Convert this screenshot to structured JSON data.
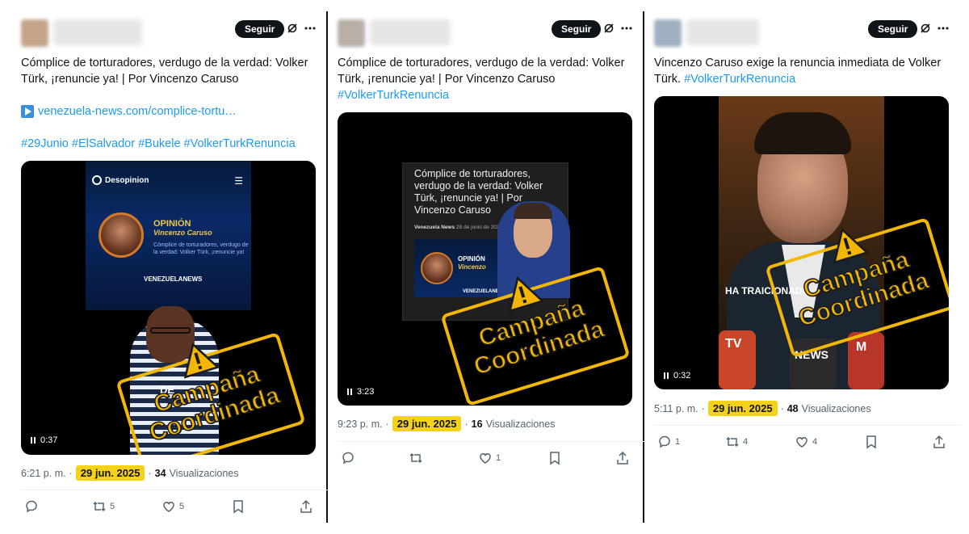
{
  "colors": {
    "stamp_yellow": "#f2b705",
    "date_highlight": "#f5d21a",
    "link_blue": "#1d9bf0",
    "text": "#0f1419",
    "muted": "#536471"
  },
  "stamp": {
    "line1": "Campaña",
    "line2": "Coordinada",
    "icon": "warning-triangle-icon"
  },
  "tweets": [
    {
      "follow_label": "Seguir",
      "text_line1": "Cómplice de torturadores, verdugo de la verdad: Volker Türk, ¡renuncie ya! | Por Vincenzo Caruso",
      "link": "venezuela-news.com/complice-tortu…",
      "hashtags": [
        "#29Junio",
        "#ElSalvador",
        "#Bukele",
        "#VolkerTurkRenuncia"
      ],
      "media": {
        "duration": "0:37",
        "logo_text": "Desopinion",
        "opinion_label": "OPINIÓN",
        "opinion_author": "Vincenzo Caruso",
        "headline": "Cómplice de torturadores, verdugo de la verdad: Volker Türk, ¡renuncie ya!",
        "brand": "VENEZUELANEWS",
        "overlay_word": "DE"
      },
      "time": "6:21 p. m.",
      "date": "29 jun. 2025",
      "views_count": "34",
      "views_label": "Visualizaciones",
      "actions": {
        "reply": "",
        "retweet": "5",
        "like": "5"
      }
    },
    {
      "follow_label": "Seguir",
      "text_line1": "Cómplice de torturadores, verdugo de la verdad: Volker Türk, ¡renuncie ya! | Por Vincenzo Caruso",
      "hashtag": "#VolkerTurkRenuncia",
      "media": {
        "duration": "3:23",
        "card_title": "Cómplice de torturadores, verdugo de la verdad: Volker Türk, ¡renuncie ya! | Por Vincenzo Caruso",
        "card_source": "Venezuela News",
        "card_date": "28 de junio de 2025",
        "opinion_label": "OPINIÓN",
        "opinion_author": "Vincenzo",
        "brand": "VENEZUELANEWS"
      },
      "time": "9:23 p. m.",
      "date": "29 jun. 2025",
      "views_count": "16",
      "views_label": "Visualizaciones",
      "actions": {
        "reply": "",
        "retweet": "",
        "like": "1"
      }
    },
    {
      "follow_label": "Seguir",
      "text_line1": "Vincenzo Caruso exige la renuncia inmediata de Volker Türk.",
      "hashtag": "#VolkerTurkRenuncia",
      "media": {
        "duration": "0:32",
        "caption": "HA TRAICIONADO",
        "mic_labels": [
          "TV",
          "NEWS",
          "M"
        ]
      },
      "time": "5:11 p. m.",
      "date": "29 jun. 2025",
      "views_count": "48",
      "views_label": "Visualizaciones",
      "actions": {
        "reply": "1",
        "retweet": "4",
        "like": "4"
      }
    }
  ]
}
